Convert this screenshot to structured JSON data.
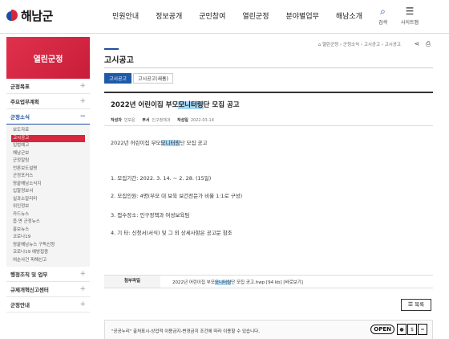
{
  "header": {
    "logo_text": "해남군",
    "nav": [
      "민원안내",
      "정보공개",
      "군민참여",
      "열린군정",
      "분야별업무",
      "해남소개"
    ],
    "search_label": "검색",
    "sitemap_label": "사이트맵"
  },
  "sidebar": {
    "title": "열린군정",
    "items_top": [
      "군정목표",
      "주요업무계획"
    ],
    "open_section": "군정소식",
    "sub_items": [
      "보도자료",
      "고시공고",
      "입법예고",
      "해남군보",
      "군정알림",
      "언론보도설명",
      "군정포커스",
      "땅끝해남소식지",
      "입찰정보서",
      "실과소알리미",
      "위인정보",
      "카드뉴스",
      "읍·면 군정뉴스",
      "홍보뉴스",
      "코로나19",
      "땅끝해남뉴스 구독신청",
      "코로나19 예방접종",
      "여순사건 피해신고"
    ],
    "active_sub": "고시공고",
    "items_bottom": [
      "행정조직 및 업무",
      "규제개혁신고센터",
      "군정안내"
    ]
  },
  "page": {
    "title": "고시공고",
    "breadcrumb": "⌂ 열린군정 › 군정소식 › 고시공고 › 고시공고",
    "tabs": [
      "고시공고",
      "고시공고(새홈)"
    ],
    "active_tab": "고시공고"
  },
  "post": {
    "title_pre": "2022년 어린이집 부모",
    "title_hl": "모니터링",
    "title_post": "단 모집 공고",
    "meta": {
      "writer_label": "작성자",
      "writer": "민보윤",
      "dept_label": "부서",
      "dept": "인구정책과",
      "date_label": "작성일",
      "date": "2022-03-14"
    },
    "body": {
      "intro_pre": "2022년 어린이집 부모",
      "intro_hl": "모니터링",
      "intro_post": "단 모집 공고",
      "line1": "1. 모집기간: 2022. 3. 14. ~ 2. 28. (15일)",
      "line2": "2. 모집인원: 4명(부모 대 보육 보건전문가 비율 1:1로 구성)",
      "line3": "3. 접수장소: 인구정책과 여성보육팀",
      "line4": "4. 기 타: 신청서(서식) 및 그 외 상세사항은 공고문 참조"
    },
    "attach_label": "첨부파일",
    "attach_pre": "2022년 어린이집 부모",
    "attach_hl": "모니터링",
    "attach_post": "단 모집 공고.hwp [94 kb] [바로보기]"
  },
  "list_button": "목록",
  "license": {
    "text": "\"공공누리\" 출처표시-상업적 이용금지-변경금지 조건에 따라 이용할 수 있습니다.",
    "badge": "OPEN"
  }
}
